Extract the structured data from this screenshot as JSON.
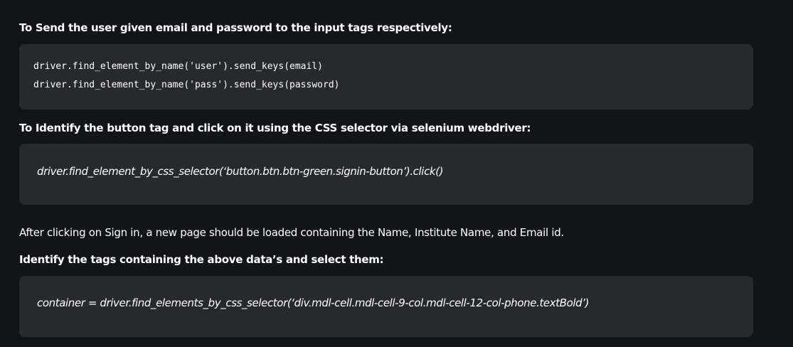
{
  "sections": {
    "heading_1": "To Send the user given email and password to the input tags respectively:",
    "code_1": {
      "line_1": "driver.find_element_by_name('user').send_keys(email)",
      "line_2": "driver.find_element_by_name('pass').send_keys(password)"
    },
    "heading_2": "To Identify the button tag and click on it using the CSS selector via selenium webdriver:",
    "code_2": "driver.find_element_by_css_selector(‘button.btn.btn-green.signin-button’).click()",
    "paragraph_1": "After clicking on Sign in, a new page should be loaded containing the Name, Institute Name, and Email id.",
    "heading_3": "Identify the tags containing the above data’s and select them:",
    "code_3": "container = driver.find_elements_by_css_selector(‘div.mdl-cell.mdl-cell-9-col.mdl-cell-12-col-phone.textBold’)"
  }
}
